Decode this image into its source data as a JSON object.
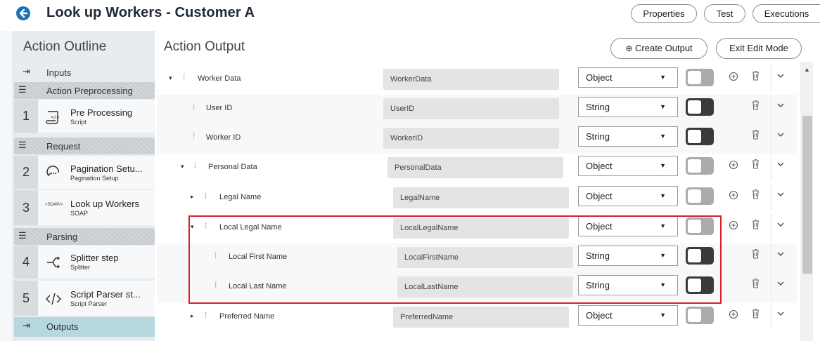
{
  "header": {
    "title": "Look up Workers - Customer A",
    "buttons": {
      "properties": "Properties",
      "test": "Test",
      "executions": "Executions"
    }
  },
  "outline": {
    "title": "Action Outline",
    "inputs": "Inputs",
    "sections": {
      "preprocessing": "Action Preprocessing",
      "request": "Request",
      "parsing": "Parsing"
    },
    "steps": [
      {
        "num": "1",
        "name": "Pre Processing",
        "sub": "Script",
        "icon": "script-scroll-icon"
      },
      {
        "num": "2",
        "name": "Pagination Setu...",
        "sub": "Pagination Setup",
        "icon": "pagination-icon"
      },
      {
        "num": "3",
        "name": "Look up Workers",
        "sub": "SOAP",
        "icon": "soap-icon",
        "icon_text": "<SOAP/>"
      },
      {
        "num": "4",
        "name": "Splitter step",
        "sub": "Splitter",
        "icon": "splitter-icon"
      },
      {
        "num": "5",
        "name": "Script Parser st...",
        "sub": "Script Parser",
        "icon": "script-parser-icon"
      }
    ],
    "outputs": "Outputs"
  },
  "output": {
    "title": "Action Output",
    "create_label": "Create Output",
    "exit_label": "Exit Edit Mode",
    "rows": [
      {
        "name": "Worker Data",
        "value": "WorkerData",
        "type": "Object",
        "toggle": "off",
        "expand": "expanded"
      },
      {
        "name": "User ID",
        "value": "UserID",
        "type": "String",
        "toggle": "on",
        "expand": "none"
      },
      {
        "name": "Worker ID",
        "value": "WorkerID",
        "type": "String",
        "toggle": "on",
        "expand": "none"
      },
      {
        "name": "Personal Data",
        "value": "PersonalData",
        "type": "Object",
        "toggle": "off",
        "expand": "expanded"
      },
      {
        "name": "Legal Name",
        "value": "LegalName",
        "type": "Object",
        "toggle": "off",
        "expand": "collapsed"
      },
      {
        "name": "Local Legal Name",
        "value": "LocalLegalName",
        "type": "Object",
        "toggle": "off",
        "expand": "expanded"
      },
      {
        "name": "Local First Name",
        "value": "LocalFirstName",
        "type": "String",
        "toggle": "on",
        "expand": "none"
      },
      {
        "name": "Local Last Name",
        "value": "LocalLastName",
        "type": "String",
        "toggle": "on",
        "expand": "none"
      },
      {
        "name": "Preferred Name",
        "value": "PreferredName",
        "type": "Object",
        "toggle": "off",
        "expand": "collapsed"
      }
    ]
  },
  "colors": {
    "highlight": "#d6202a",
    "toggle_on": "#3a3a3a",
    "toggle_off": "#a9abad",
    "field_bg": "#e2e4e6"
  }
}
